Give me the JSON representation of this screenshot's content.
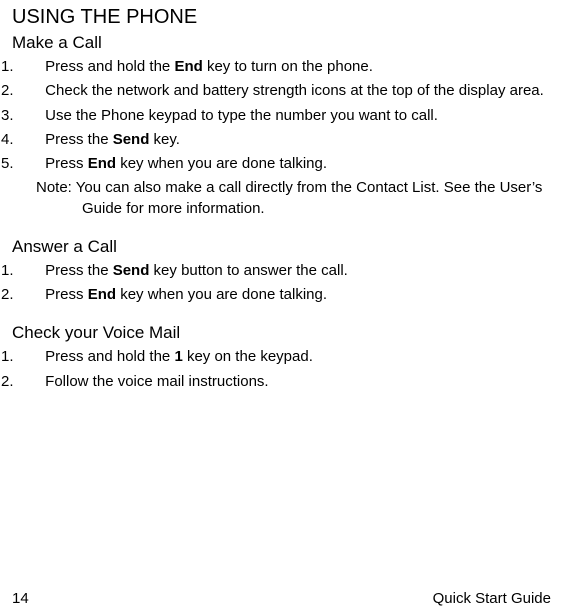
{
  "title": "USING THE PHONE",
  "sections": [
    {
      "heading": "Make a Call",
      "steps": [
        {
          "num": "1.",
          "pre": "Press and hold the ",
          "bold": "End",
          "post": " key to turn on the phone."
        },
        {
          "num": "2.",
          "pre": "Check the network and battery strength icons at the top of the display area.",
          "bold": "",
          "post": ""
        },
        {
          "num": "3.",
          "pre": "Use the Phone keypad to type the number you want to call.",
          "bold": "",
          "post": ""
        },
        {
          "num": "4.",
          "pre": "Press the ",
          "bold": "Send",
          "post": " key."
        },
        {
          "num": "5.",
          "pre": "Press ",
          "bold": "End",
          "post": " key when you are done talking."
        }
      ],
      "note": {
        "label": "Note:",
        "text": "You can also make a call directly from the Contact List. See the User’s Guide for more information."
      }
    },
    {
      "heading": "Answer a Call",
      "steps": [
        {
          "num": "1.",
          "pre": "Press the ",
          "bold": "Send",
          "post": " key button to answer the call."
        },
        {
          "num": "2.",
          "pre": "Press ",
          "bold": "End",
          "post": " key when you are done talking."
        }
      ]
    },
    {
      "heading": "Check your Voice Mail",
      "steps": [
        {
          "num": "1.",
          "pre": "Press and hold the ",
          "bold": "1",
          "post": " key on the keypad."
        },
        {
          "num": "2.",
          "pre": "Follow the voice mail instructions.",
          "bold": "",
          "post": ""
        }
      ]
    }
  ],
  "footer": {
    "page": "14",
    "doc": "Quick Start Guide"
  }
}
